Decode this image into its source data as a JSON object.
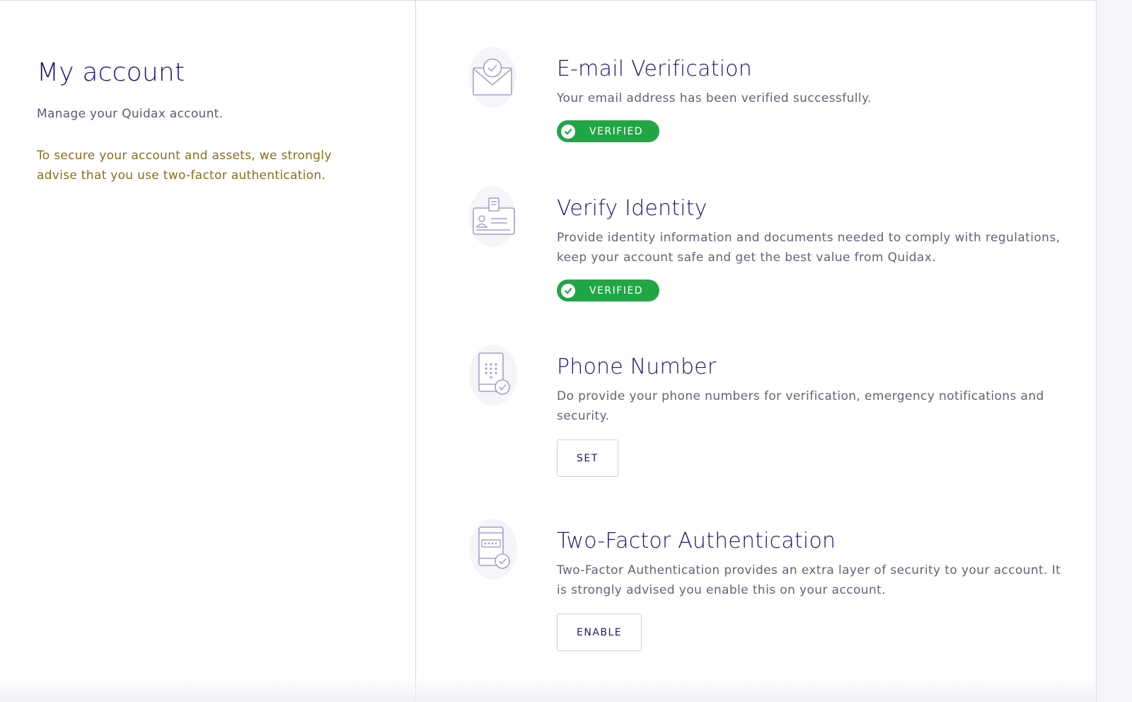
{
  "account": {
    "title": "My account",
    "subtitle": "Manage your Quidax account.",
    "security_tip": "To secure your account and assets, we strongly advise that you use two-factor authentication."
  },
  "colors": {
    "heading": "#25127a",
    "body_text": "#62627e",
    "tip_text": "#8a6d1c",
    "verified_badge": "#21a645",
    "icon_stroke": "#a59fd1",
    "icon_blob": "#f4f4f9"
  },
  "sections": {
    "email": {
      "icon": "envelope-check-icon",
      "title": "E-mail Verification",
      "description": "Your email address has been verified successfully.",
      "status": "VERIFIED"
    },
    "identity": {
      "icon": "id-card-icon",
      "title": "Verify Identity",
      "description": "Provide identity information and documents needed to comply with regulations, keep your account safe and get the best value from Quidax.",
      "status": "VERIFIED"
    },
    "phone": {
      "icon": "phone-keypad-check-icon",
      "title": "Phone Number",
      "description": "Do provide your phone numbers for verification, emergency notifications and security.",
      "button_label": "SET"
    },
    "two_factor": {
      "icon": "phone-password-check-icon",
      "title": "Two-Factor Authentication",
      "description": "Two-Factor Authentication provides an extra layer of security to your account. It is strongly advised you enable this on your account.",
      "button_label": "ENABLE"
    }
  }
}
